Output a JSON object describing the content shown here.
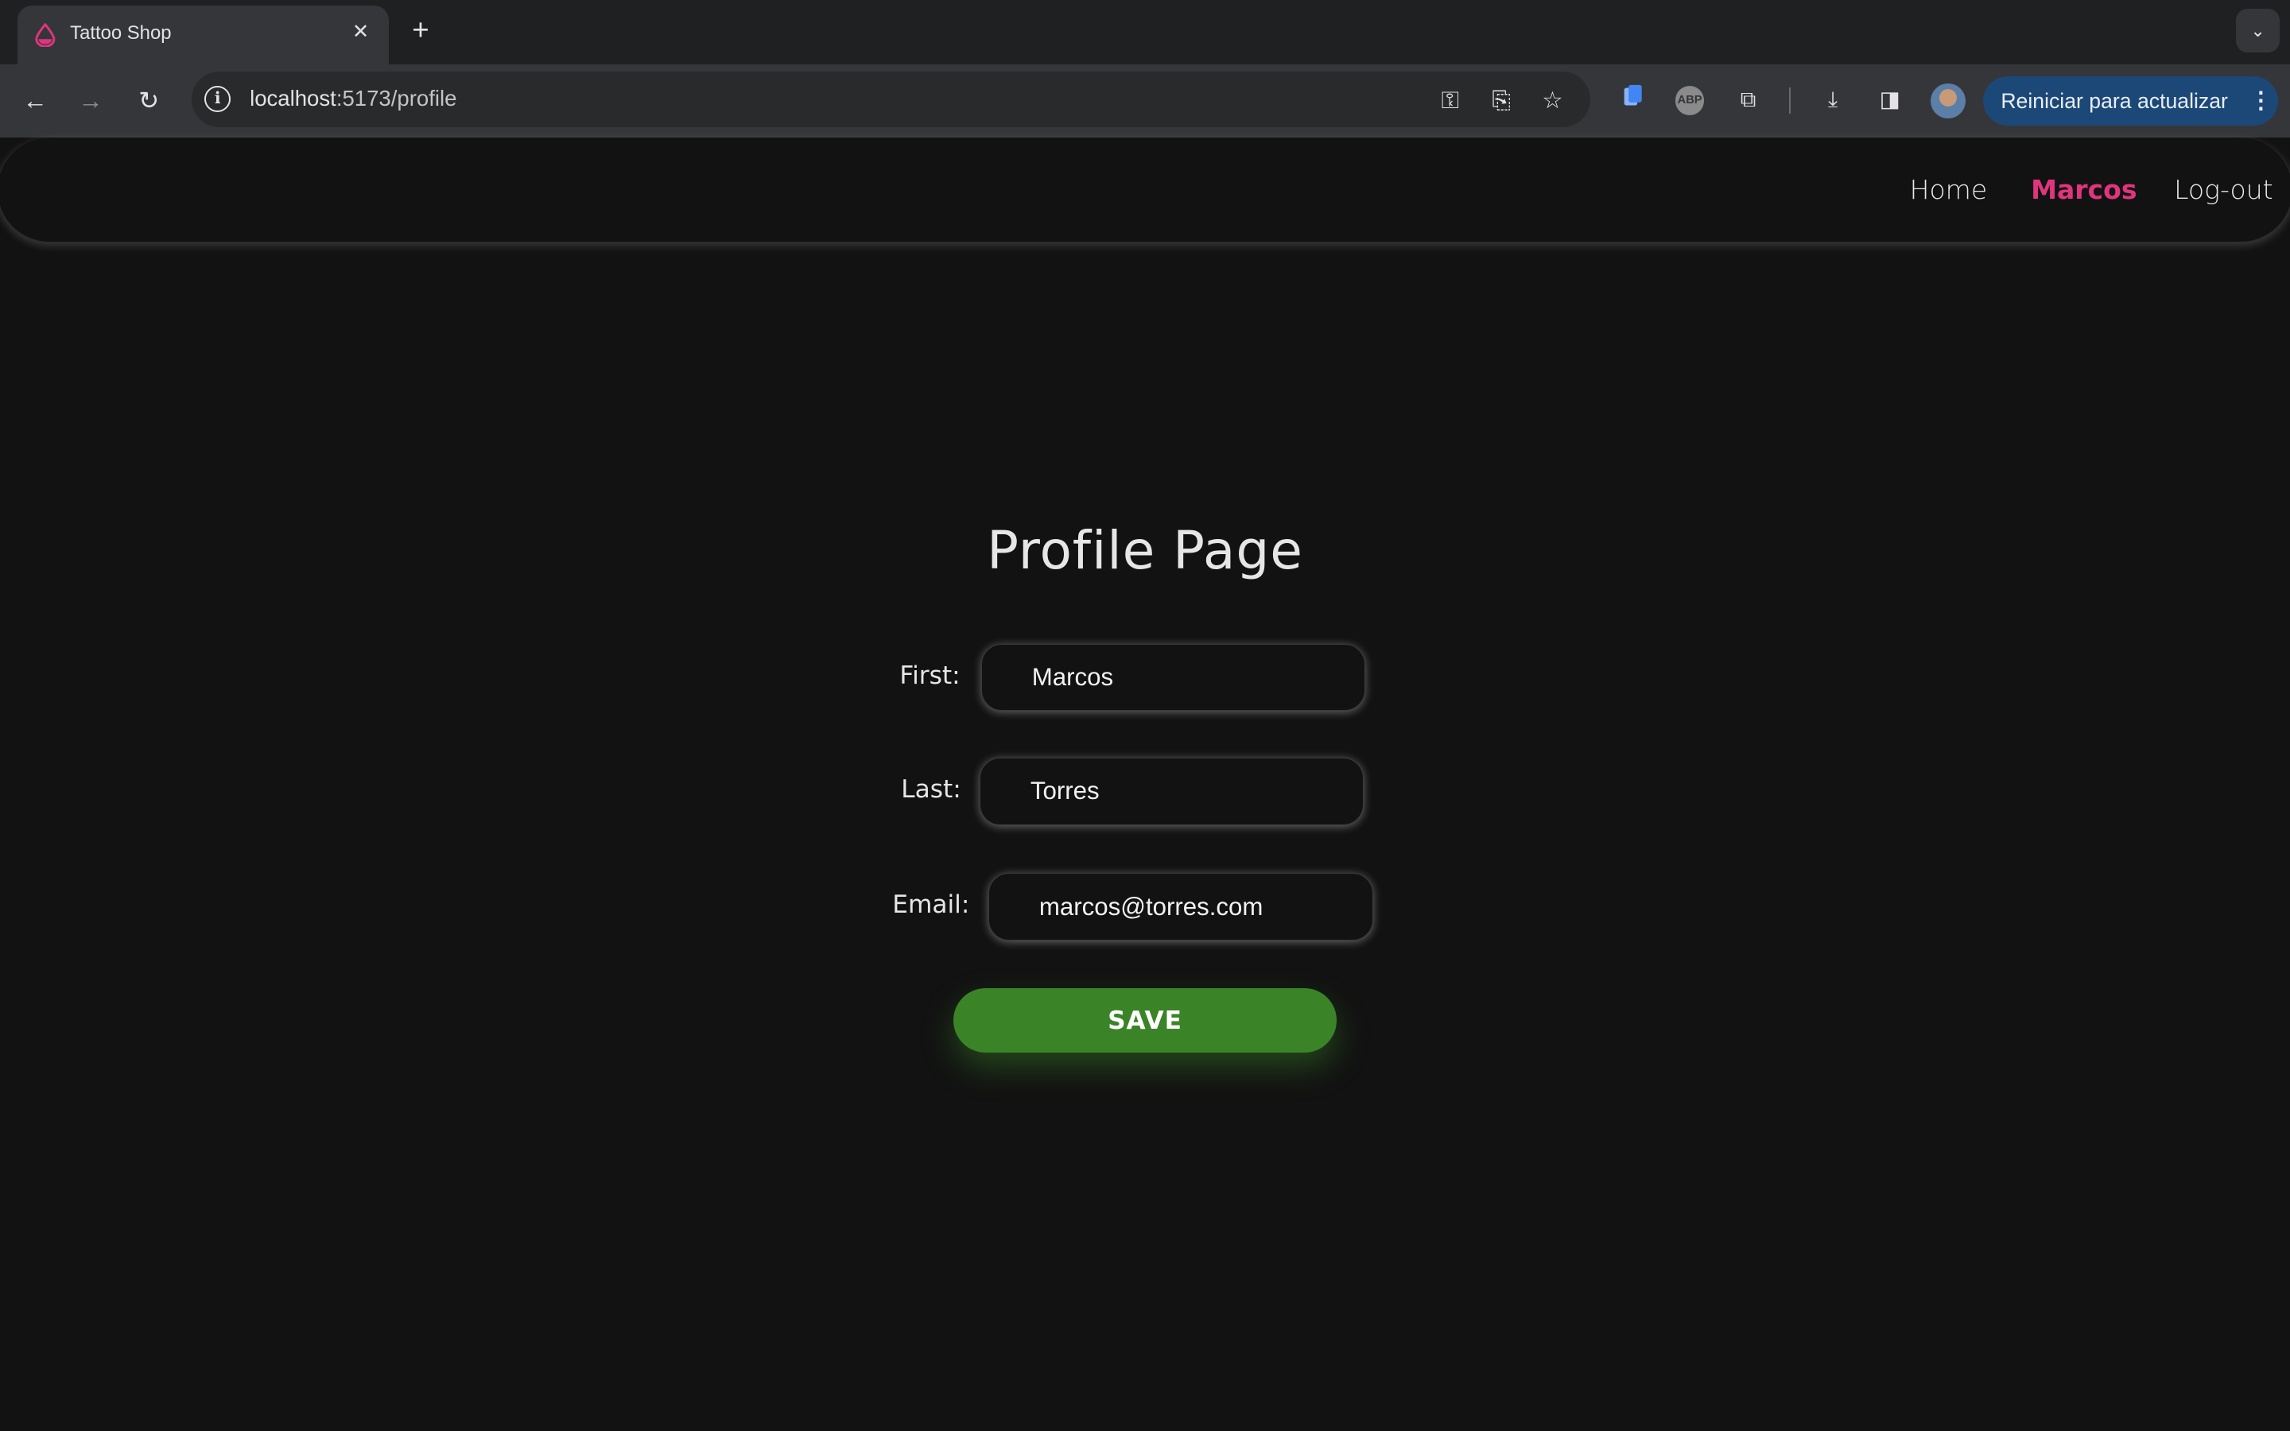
{
  "browser": {
    "tab": {
      "title": "Tattoo Shop"
    },
    "url": {
      "host": "localhost",
      "path": ":5173/profile"
    },
    "update_button": {
      "label": "Reiniciar para actualizar"
    }
  },
  "nav": {
    "home": "Home",
    "user": "Marcos",
    "logout": "Log-out"
  },
  "profile": {
    "title": "Profile Page",
    "first_label": "First:",
    "first_value": "Marcos",
    "last_label": "Last:",
    "last_value": "Torres",
    "email_label": "Email:",
    "email_value": "marcos@torres.com",
    "save_label": "SAVE"
  },
  "colors": {
    "accent": "#e0357e",
    "save_button": "#3a8427",
    "background": "#121212"
  }
}
